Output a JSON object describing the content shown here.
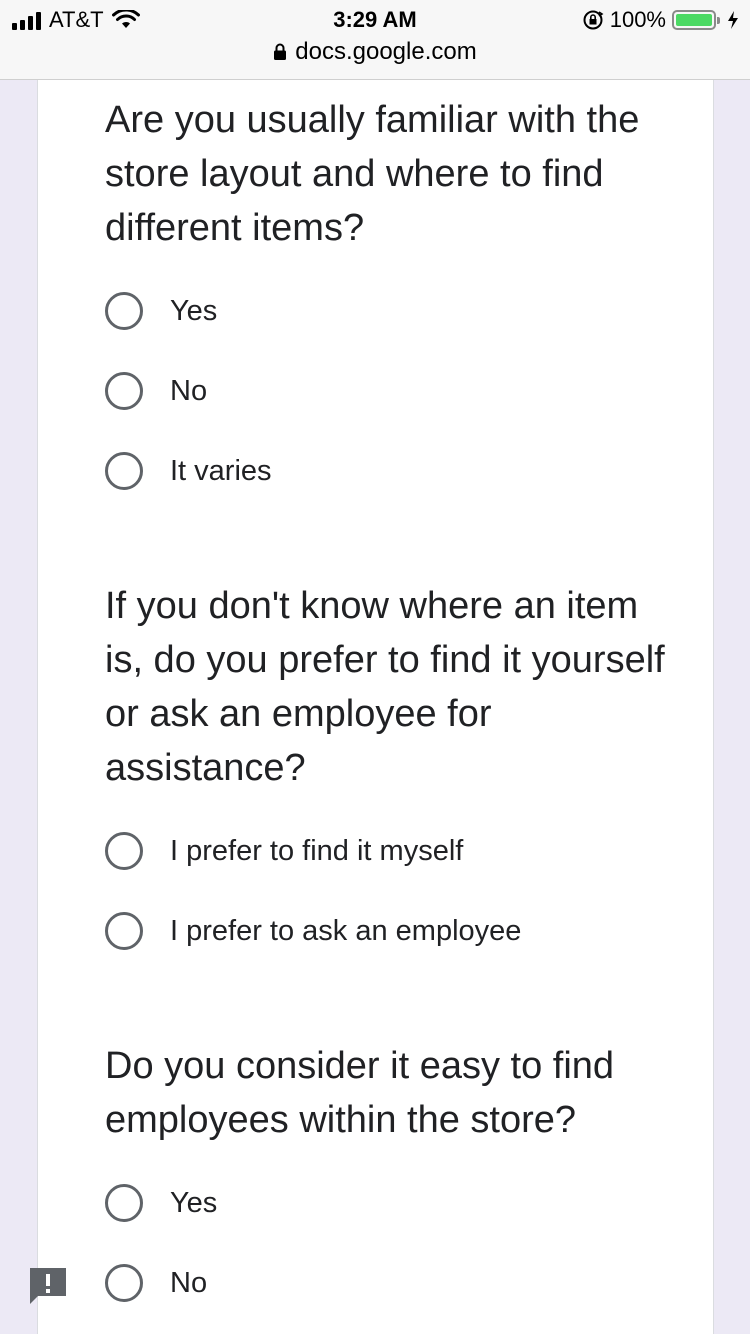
{
  "status_bar": {
    "carrier": "AT&T",
    "time": "3:29 AM",
    "battery_percent": "100%",
    "battery_level": 1.0,
    "icons": [
      "signal-icon",
      "wifi-icon",
      "orientation-lock-icon",
      "battery-icon",
      "charging-icon"
    ]
  },
  "browser": {
    "url": "docs.google.com",
    "lock_icon": "lock-icon"
  },
  "questions": [
    {
      "text": "Are you usually familiar with the store layout and where to find different items?",
      "options": [
        "Yes",
        "No",
        "It varies"
      ]
    },
    {
      "text": "If you don't know where an item is, do you prefer to find it yourself or ask an employee for assistance?",
      "options": [
        "I prefer to find it myself",
        "I prefer to ask an employee"
      ]
    },
    {
      "text": "Do you consider it easy to find employees within the store?",
      "options": [
        "Yes",
        "No"
      ]
    }
  ],
  "colors": {
    "background": "#ece9f5",
    "card": "#ffffff",
    "radio_border": "#5f6368",
    "text": "#202124",
    "feedback_icon": "#5f6368"
  }
}
